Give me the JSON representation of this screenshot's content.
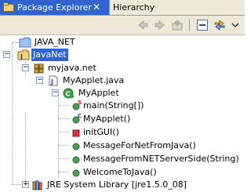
{
  "tabs": {
    "active_label": "Package Explorer",
    "close_glyph": "✕",
    "inactive_label": "Hierarchy"
  },
  "toolbar": {
    "back_icon": "back-arrow-icon",
    "forward_icon": "forward-arrow-icon",
    "up_icon": "up-folder-icon",
    "collapse_icon": "collapse-all-icon",
    "link_icon": "link-with-editor-icon",
    "menu_icon": "view-menu-chevron-icon"
  },
  "tree": {
    "items": [
      {
        "label": "JAVA_NET",
        "icon": "folder-icon"
      },
      {
        "label": "JavaNet",
        "icon": "java-project-icon",
        "selected": true
      },
      {
        "label": "myjava.net",
        "icon": "package-icon"
      },
      {
        "label": "MyApplet.java",
        "icon": "java-file-icon"
      },
      {
        "label": "MyApplet",
        "icon": "class-icon"
      },
      {
        "label": "main(String[])",
        "icon": "static-public-method-icon"
      },
      {
        "label": "MyApplet()",
        "icon": "constructor-icon"
      },
      {
        "label": "initGUI()",
        "icon": "private-method-icon"
      },
      {
        "label": "MessageForNetFromJava()",
        "icon": "public-method-icon"
      },
      {
        "label": "MessageFromNETServerSide(String)",
        "icon": "public-method-icon"
      },
      {
        "label": "WelcomeToJava()",
        "icon": "public-method-icon"
      },
      {
        "label": "JRE System Library [jre1.5.0_08]",
        "icon": "library-icon"
      }
    ]
  },
  "colors": {
    "selection": "#3163ce",
    "method_public": "#2f9a38",
    "method_private": "#d23535",
    "folder": "#7fb3e6",
    "class": "#2f9a38"
  }
}
